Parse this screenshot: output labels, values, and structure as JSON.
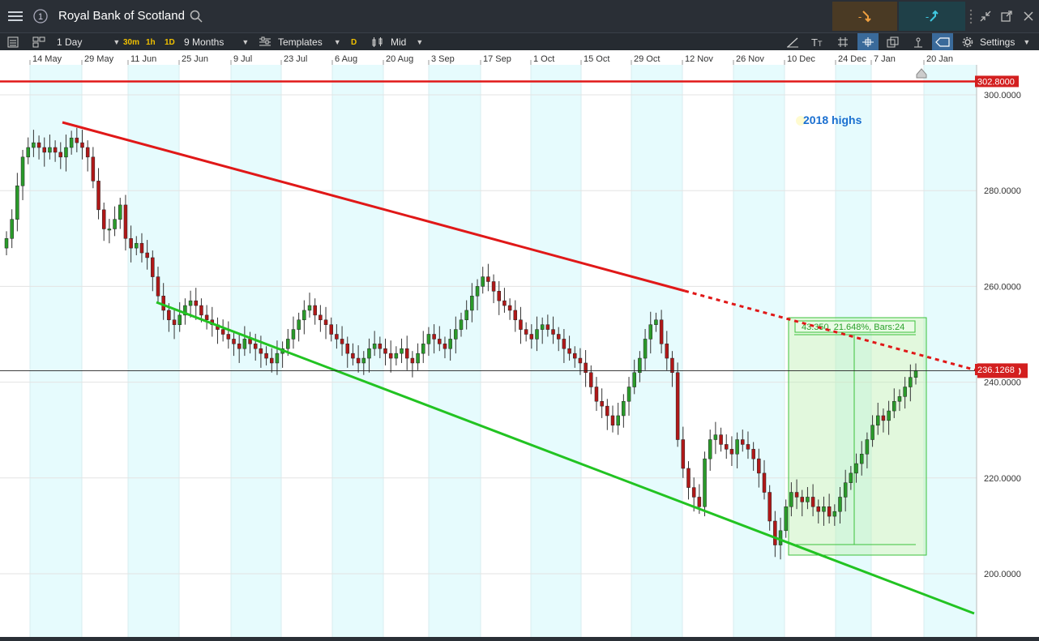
{
  "window": {
    "title": "Royal Bank of Scotland",
    "info_badge": "1"
  },
  "toolbar": {
    "interval": "1 Day",
    "quick_30m": "30m",
    "quick_1h": "1h",
    "quick_1d": "1D",
    "range": "9 Months",
    "templates": "Templates",
    "d_badge": "D",
    "price_mode": "Mid",
    "settings": "Settings",
    "sell_label": "-",
    "buy_label": "-"
  },
  "chart_data": {
    "type": "candlestick",
    "x_ticks": [
      "14 May",
      "29 May",
      "11 Jun",
      "25 Jun",
      "9 Jul",
      "23 Jul",
      "6 Aug",
      "20 Aug",
      "3 Sep",
      "17 Sep",
      "1 Oct",
      "15 Oct",
      "29 Oct",
      "12 Nov",
      "26 Nov",
      "10 Dec",
      "24 Dec",
      "7 Jan",
      "20 Jan"
    ],
    "y_ticks": [
      "300.0000",
      "280.0000",
      "260.0000",
      "240.0000",
      "220.0000",
      "200.0000"
    ],
    "ylim": [
      190,
      305
    ],
    "current_price": "242.4000",
    "resistance_level": "302.8000",
    "resistance_annotation": "2018 highs",
    "trendline_value": "236.1268",
    "measure_label": "43.350, 21.648%, Bars:24",
    "closes": [
      270,
      274,
      281,
      287,
      289,
      290,
      289,
      288,
      289,
      288,
      287,
      289,
      291,
      290,
      289,
      287,
      282,
      276,
      272,
      272,
      274,
      277,
      270,
      268,
      269,
      267,
      266,
      262,
      258,
      255,
      253,
      252,
      254,
      256,
      257,
      256,
      254,
      253,
      252,
      251,
      250,
      249,
      248,
      247,
      249,
      248,
      247,
      246,
      245,
      244,
      246,
      247,
      249,
      251,
      253,
      255,
      256,
      254,
      253,
      252,
      250,
      249,
      248,
      246,
      245,
      244,
      245,
      247,
      248,
      247,
      246,
      245,
      246,
      247,
      245,
      244,
      246,
      248,
      250,
      249,
      248,
      247,
      249,
      251,
      253,
      255,
      258,
      260,
      262,
      261,
      259,
      257,
      256,
      255,
      253,
      251,
      250,
      249,
      251,
      252,
      251,
      250,
      249,
      247,
      246,
      245,
      244,
      242,
      239,
      236,
      235,
      233,
      231,
      233,
      236,
      239,
      242,
      245,
      249,
      252,
      253,
      248,
      245,
      242,
      228,
      222,
      218,
      216,
      214,
      224,
      228,
      229,
      227,
      226,
      225,
      228,
      227,
      226,
      224,
      221,
      217,
      211,
      206,
      209,
      214,
      217,
      216,
      215,
      216,
      214,
      213,
      214,
      212,
      213,
      216,
      219,
      221,
      223,
      225,
      228,
      231,
      233,
      232,
      234,
      236,
      237,
      239,
      241,
      242.4
    ]
  }
}
